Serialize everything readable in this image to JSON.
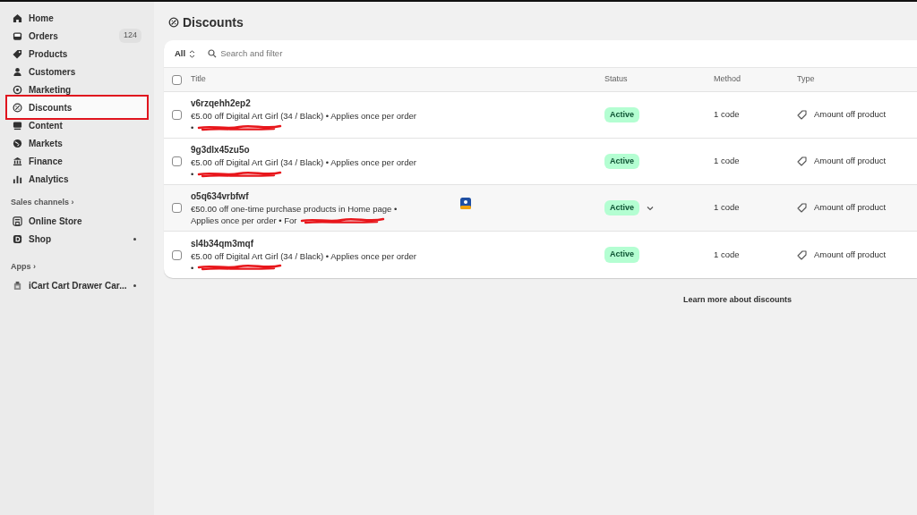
{
  "sidebar": {
    "items": [
      {
        "label": "Home",
        "selected": false
      },
      {
        "label": "Orders",
        "selected": false,
        "badge": "124"
      },
      {
        "label": "Products",
        "selected": false
      },
      {
        "label": "Customers",
        "selected": false
      },
      {
        "label": "Marketing",
        "selected": false
      },
      {
        "label": "Discounts",
        "selected": true,
        "annotated": true
      },
      {
        "label": "Content",
        "selected": false
      },
      {
        "label": "Markets",
        "selected": false
      },
      {
        "label": "Finance",
        "selected": false
      },
      {
        "label": "Analytics",
        "selected": false
      }
    ],
    "sections": [
      {
        "title": "Sales channels ›",
        "items": [
          {
            "label": "Online Store",
            "dot": false
          },
          {
            "label": "Shop",
            "dot": true
          }
        ]
      },
      {
        "title": "Apps ›",
        "items": [
          {
            "label": "iCart Cart Drawer Car...",
            "dot": true
          }
        ]
      }
    ]
  },
  "page": {
    "title": "Discounts"
  },
  "filter": {
    "view": "All",
    "placeholder": "Search and filter"
  },
  "table": {
    "select_all_checked": false,
    "columns": [
      "Title",
      "Status",
      "Method",
      "Type"
    ],
    "rows": [
      {
        "checked": false,
        "code": "v6rzqehh2ep2",
        "description_lines": [
          "€5.00 off Digital Art Girl (34 / Black) • Applies once per order",
          "•"
        ],
        "status": "Active",
        "method": "1 code",
        "type": "Amount off product",
        "hovered": false,
        "app_icon": false
      },
      {
        "checked": false,
        "code": "9g3dlx45zu5o",
        "description_lines": [
          "€5.00 off Digital Art Girl (34 / Black) • Applies once per order",
          "•"
        ],
        "status": "Active",
        "method": "1 code",
        "type": "Amount off product",
        "hovered": false,
        "app_icon": false
      },
      {
        "checked": false,
        "code": "o5q634vrbfwf",
        "description_lines": [
          "€50.00 off one-time purchase products in Home page •",
          "Applies once per order • For"
        ],
        "status": "Active",
        "method": "1 code",
        "type": "Amount off product",
        "hovered": true,
        "app_icon": true
      },
      {
        "checked": false,
        "code": "sl4b34qm3mqf",
        "description_lines": [
          "€5.00 off Digital Art Girl (34 / Black) • Applies once per order",
          "•"
        ],
        "status": "Active",
        "method": "1 code",
        "type": "Amount off product",
        "hovered": false,
        "app_icon": false
      }
    ]
  },
  "footer_link": "Learn more about discounts"
}
